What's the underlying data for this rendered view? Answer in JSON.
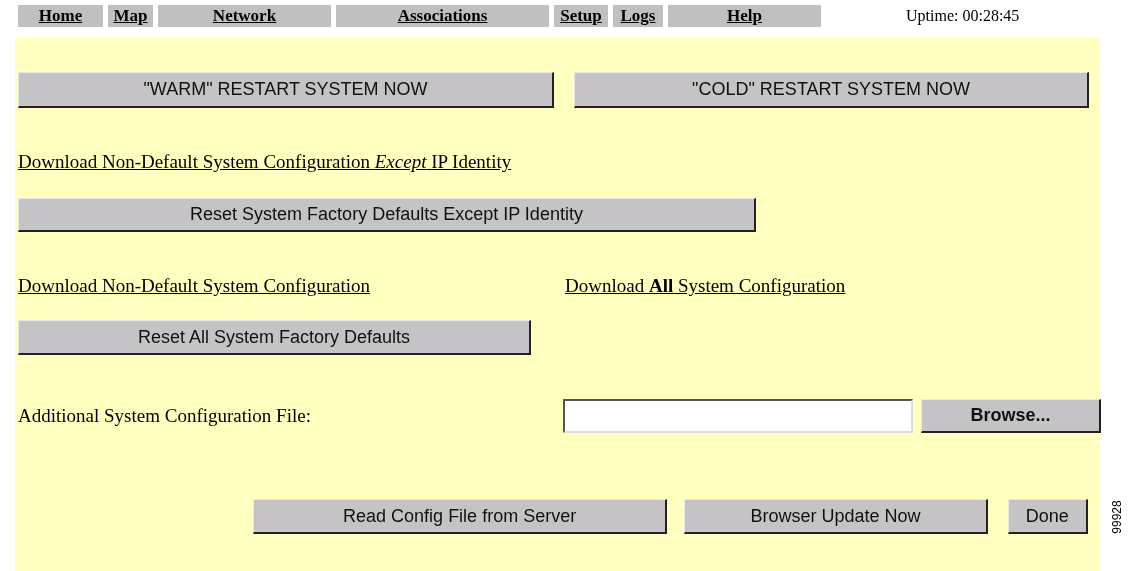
{
  "nav": {
    "items": [
      "Home",
      "Map",
      "Network",
      "Associations",
      "Setup",
      "Logs",
      "Help"
    ],
    "uptime": "Uptime: 00:28:45"
  },
  "restart_buttons": [
    "\"WARM\" RESTART SYSTEM NOW",
    "\"COLD\" RESTART SYSTEM NOW"
  ],
  "download_except_link": "Download Non-Default System Configuration *Except* IP Identity",
  "reset_except_button": "Reset System Factory Defaults Except IP Identity",
  "download_links": [
    "Download Non-Default System Configuration",
    "Download **All** System Configuration"
  ],
  "reset_all_button": "Reset All System Factory Defaults",
  "config_file": {
    "label": "Additional System Configuration File:",
    "browse": "Browse..."
  },
  "bottom_buttons": [
    "Read Config File from Server",
    "Browser Update Now",
    "Done"
  ],
  "figure_id": "99928"
}
